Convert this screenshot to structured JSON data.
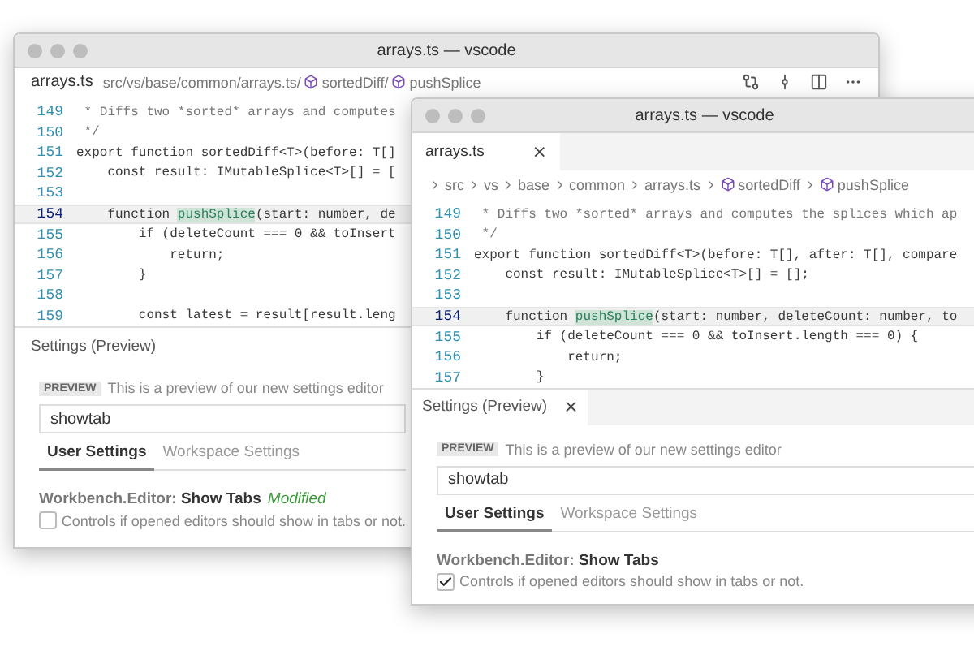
{
  "back_window": {
    "title": "arrays.ts — vscode",
    "breadcrumb": [
      {
        "text": "arrays.ts",
        "kind": "file"
      },
      {
        "text": "src/vs/base/common/arrays.ts/",
        "kind": "path"
      },
      {
        "text": "sortedDiff/",
        "kind": "symbol"
      },
      {
        "text": "pushSplice",
        "kind": "symbol"
      }
    ],
    "code_lines": [
      {
        "number": "149",
        "current": false,
        "kind": "comment",
        "text": " * Diffs two *sorted* arrays and computes"
      },
      {
        "number": "150",
        "current": false,
        "kind": "comment",
        "text": " */"
      },
      {
        "number": "151",
        "current": false,
        "kind": "code",
        "text": "export function sortedDiff<T>(before: T[]"
      },
      {
        "number": "152",
        "current": false,
        "kind": "code",
        "text": "    const result: IMutableSplice<T>[] = ["
      },
      {
        "number": "153",
        "current": false,
        "kind": "blank"
      },
      {
        "number": "154",
        "current": true,
        "kind": "code",
        "text": "    function ",
        "match": "pushSplice",
        "after": "(start: number, de"
      },
      {
        "number": "155",
        "current": false,
        "kind": "code",
        "text": "        if (deleteCount === 0 && toInsert"
      },
      {
        "number": "156",
        "current": false,
        "kind": "code",
        "text": "            return;"
      },
      {
        "number": "157",
        "current": false,
        "kind": "code",
        "text": "        }"
      },
      {
        "number": "158",
        "current": false,
        "kind": "blank"
      },
      {
        "number": "159",
        "current": false,
        "kind": "code",
        "text": "        const latest = result[result.leng"
      }
    ],
    "settings": {
      "title": "Settings (Preview)",
      "badge": "PREVIEW",
      "description": "This is a preview of our new settings editor",
      "search": {
        "value": "showtab"
      },
      "tabs": [
        {
          "label": "User Settings",
          "selected": true
        },
        {
          "label": "Workspace Settings",
          "selected": false
        }
      ],
      "setting": {
        "category": "Workbench.Editor:",
        "name": "Show Tabs",
        "modified": "Modified",
        "description": "Controls if opened editors should show in tabs or not.",
        "checked": false
      }
    }
  },
  "front_window": {
    "title": "arrays.ts — vscode",
    "tab": {
      "label": "arrays.ts",
      "close": "×"
    },
    "breadcrumb": [
      {
        "text": "src",
        "kind": "folder"
      },
      {
        "text": "vs",
        "kind": "folder"
      },
      {
        "text": "base",
        "kind": "folder"
      },
      {
        "text": "common",
        "kind": "folder"
      },
      {
        "text": "arrays.ts",
        "kind": "folder"
      },
      {
        "text": "sortedDiff",
        "kind": "symbol"
      },
      {
        "text": "pushSplice",
        "kind": "symbol"
      }
    ],
    "code_lines": [
      {
        "number": "149",
        "current": false,
        "kind": "comment",
        "text": " * Diffs two *sorted* arrays and computes the splices which ap"
      },
      {
        "number": "150",
        "current": false,
        "kind": "comment",
        "text": " */"
      },
      {
        "number": "151",
        "current": false,
        "kind": "code",
        "text": "export function sortedDiff<T>(before: T[], after: T[], compare"
      },
      {
        "number": "152",
        "current": false,
        "kind": "code",
        "text": "    const result: IMutableSplice<T>[] = [];"
      },
      {
        "number": "153",
        "current": false,
        "kind": "blank"
      },
      {
        "number": "154",
        "current": true,
        "kind": "code",
        "text": "    function ",
        "match": "pushSplice",
        "after": "(start: number, deleteCount: number, to"
      },
      {
        "number": "155",
        "current": false,
        "kind": "code",
        "text": "        if (deleteCount === 0 && toInsert.length === 0) {"
      },
      {
        "number": "156",
        "current": false,
        "kind": "code",
        "text": "            return;"
      },
      {
        "number": "157",
        "current": false,
        "kind": "code",
        "text": "        }"
      }
    ],
    "settings": {
      "title": "Settings (Preview)",
      "close": "×",
      "badge": "PREVIEW",
      "description": "This is a preview of our new settings editor",
      "search": {
        "value": "showtab"
      },
      "tabs": [
        {
          "label": "User Settings",
          "selected": true
        },
        {
          "label": "Workspace Settings",
          "selected": false
        }
      ],
      "setting": {
        "category": "Workbench.Editor:",
        "name": "Show Tabs",
        "description": "Controls if opened editors should show in tabs or not.",
        "checked": true
      }
    }
  }
}
